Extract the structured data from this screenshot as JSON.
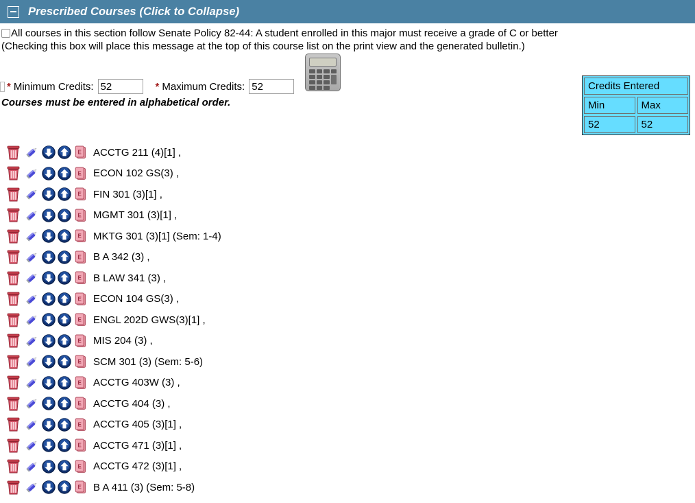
{
  "header": {
    "title": "Prescribed Courses (Click to Collapse)",
    "collapse_icon": "minus-box-icon",
    "bar_color": "#4a81a3"
  },
  "policy": {
    "checkbox_checked": false,
    "line1": "All courses in this section follow Senate Policy 82-44: A student enrolled in this major must receive a grade of C or better",
    "line2": "(Checking this box will place this message at the top of this course list on the print view and the generated bulletin.)"
  },
  "credits": {
    "required_marker": "*",
    "min_label": "Minimum Credits:",
    "min_value": "52",
    "max_label": "Maximum Credits:",
    "max_value": "52",
    "calculator_icon": "calculator-icon",
    "alpha_note": "Courses must be entered in alphabetical order."
  },
  "credits_table": {
    "title": "Credits Entered",
    "col_min": "Min",
    "col_max": "Max",
    "val_min": "52",
    "val_max": "52",
    "background": "#66ddff"
  },
  "row_icons": {
    "delete": "trash-icon",
    "edit": "pencil-icon",
    "move_down": "arrow-down-circle-icon",
    "move_up": "arrow-up-circle-icon",
    "equivalent": "equivalent-course-icon"
  },
  "courses": [
    {
      "label": "ACCTG 211 (4)[1] ,"
    },
    {
      "label": "ECON 102 GS(3) ,"
    },
    {
      "label": "FIN 301 (3)[1] ,"
    },
    {
      "label": "MGMT 301 (3)[1] ,"
    },
    {
      "label": "MKTG 301 (3)[1] (Sem: 1-4)"
    },
    {
      "label": "B A 342 (3) ,"
    },
    {
      "label": "B LAW 341 (3) ,"
    },
    {
      "label": "ECON 104 GS(3) ,"
    },
    {
      "label": "ENGL 202D GWS(3)[1] ,"
    },
    {
      "label": "MIS 204 (3) ,"
    },
    {
      "label": "SCM 301 (3) (Sem: 5-6)"
    },
    {
      "label": "ACCTG 403W (3) ,"
    },
    {
      "label": "ACCTG 404 (3) ,"
    },
    {
      "label": "ACCTG 405 (3)[1] ,"
    },
    {
      "label": "ACCTG 471 (3)[1] ,"
    },
    {
      "label": "ACCTG 472 (3)[1] ,"
    },
    {
      "label": "B A 411 (3) (Sem: 5-8)"
    }
  ]
}
